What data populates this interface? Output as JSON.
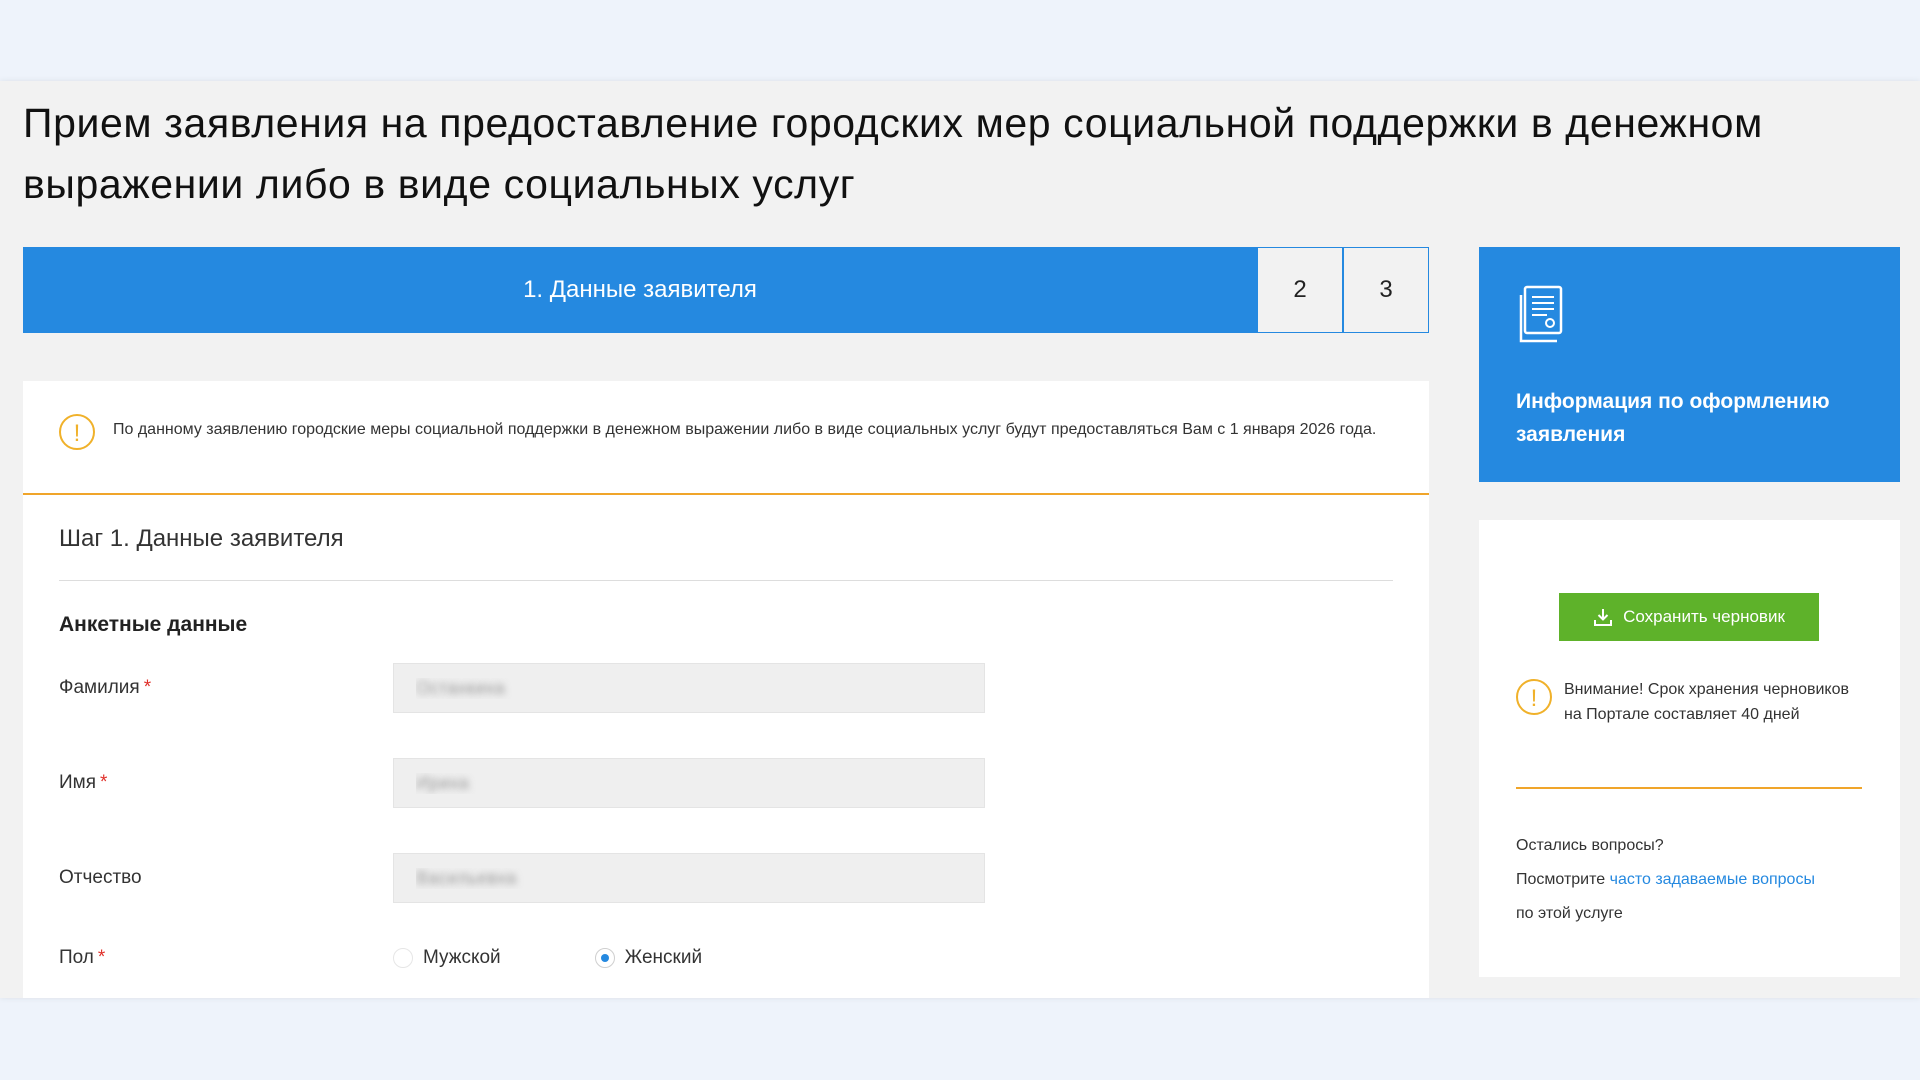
{
  "page": {
    "title": "Прием заявления на предоставление городских мер социальной поддержки в денежном выражении либо в виде социальных услуг"
  },
  "stepper": {
    "active_label": "1. Данные заявителя",
    "steps": [
      "2",
      "3"
    ]
  },
  "notice": {
    "icon": "!",
    "text": "По данному заявлению городские меры социальной поддержки в денежном выражении либо в виде социальных услуг будут предоставляться Вам с 1 января 2026 года."
  },
  "form": {
    "step_heading": "Шаг 1. Данные заявителя",
    "section_title": "Анкетные данные",
    "required_mark": "*",
    "fields": {
      "surname": {
        "label": "Фамилия",
        "value": "Останкина"
      },
      "name": {
        "label": "Имя",
        "value": "Ирина"
      },
      "patronymic": {
        "label": "Отчество",
        "value": "Васильевна"
      }
    },
    "gender": {
      "label": "Пол",
      "options": [
        "Мужской",
        "Женский"
      ],
      "selected": "Женский"
    }
  },
  "sidebar": {
    "info_title": "Информация по оформлению заявления",
    "save_label": "Сохранить черновик",
    "warning_text": "Внимание! Срок хранения черновиков на Портале составляет 40 дней",
    "faq_line1": "Остались вопросы?",
    "faq_line2_prefix": "Посмотрите ",
    "faq_link": "часто задаваемые вопросы",
    "faq_line3": "по этой услуге"
  },
  "colors": {
    "accent": "#2589e0",
    "warning": "#f0a52a",
    "save": "#5eb22a",
    "required": "#e0302a"
  }
}
